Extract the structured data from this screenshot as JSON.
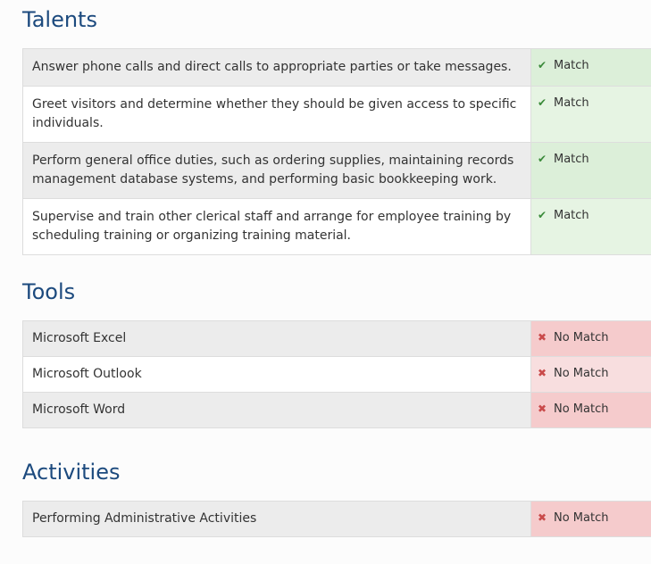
{
  "talents": {
    "title": "Talents",
    "rows": [
      {
        "text": "Answer phone calls and direct calls to appropriate parties or take messages.",
        "status": "Match"
      },
      {
        "text": "Greet visitors and determine whether they should be given access to specific individuals.",
        "status": "Match"
      },
      {
        "text": "Perform general office duties, such as ordering supplies, maintaining records management database systems, and performing basic bookkeeping work.",
        "status": "Match"
      },
      {
        "text": "Supervise and train other clerical staff and arrange for employee training by scheduling training or organizing training material.",
        "status": "Match"
      }
    ]
  },
  "tools": {
    "title": "Tools",
    "rows": [
      {
        "text": "Microsoft Excel",
        "status": "No Match"
      },
      {
        "text": "Microsoft Outlook",
        "status": "No Match"
      },
      {
        "text": "Microsoft Word",
        "status": "No Match"
      }
    ]
  },
  "activities": {
    "title": "Activities",
    "rows": [
      {
        "text": "Performing Administrative Activities",
        "status": "No Match"
      }
    ]
  },
  "icons": {
    "match": "check-icon",
    "no_match": "x-icon"
  },
  "colors": {
    "title": "#1c4a7e",
    "match_icon": "#3a8a3a",
    "no_match_icon": "#c94a4a",
    "match_bg": "#dcefd9",
    "no_match_bg": "#f5cbcc"
  }
}
